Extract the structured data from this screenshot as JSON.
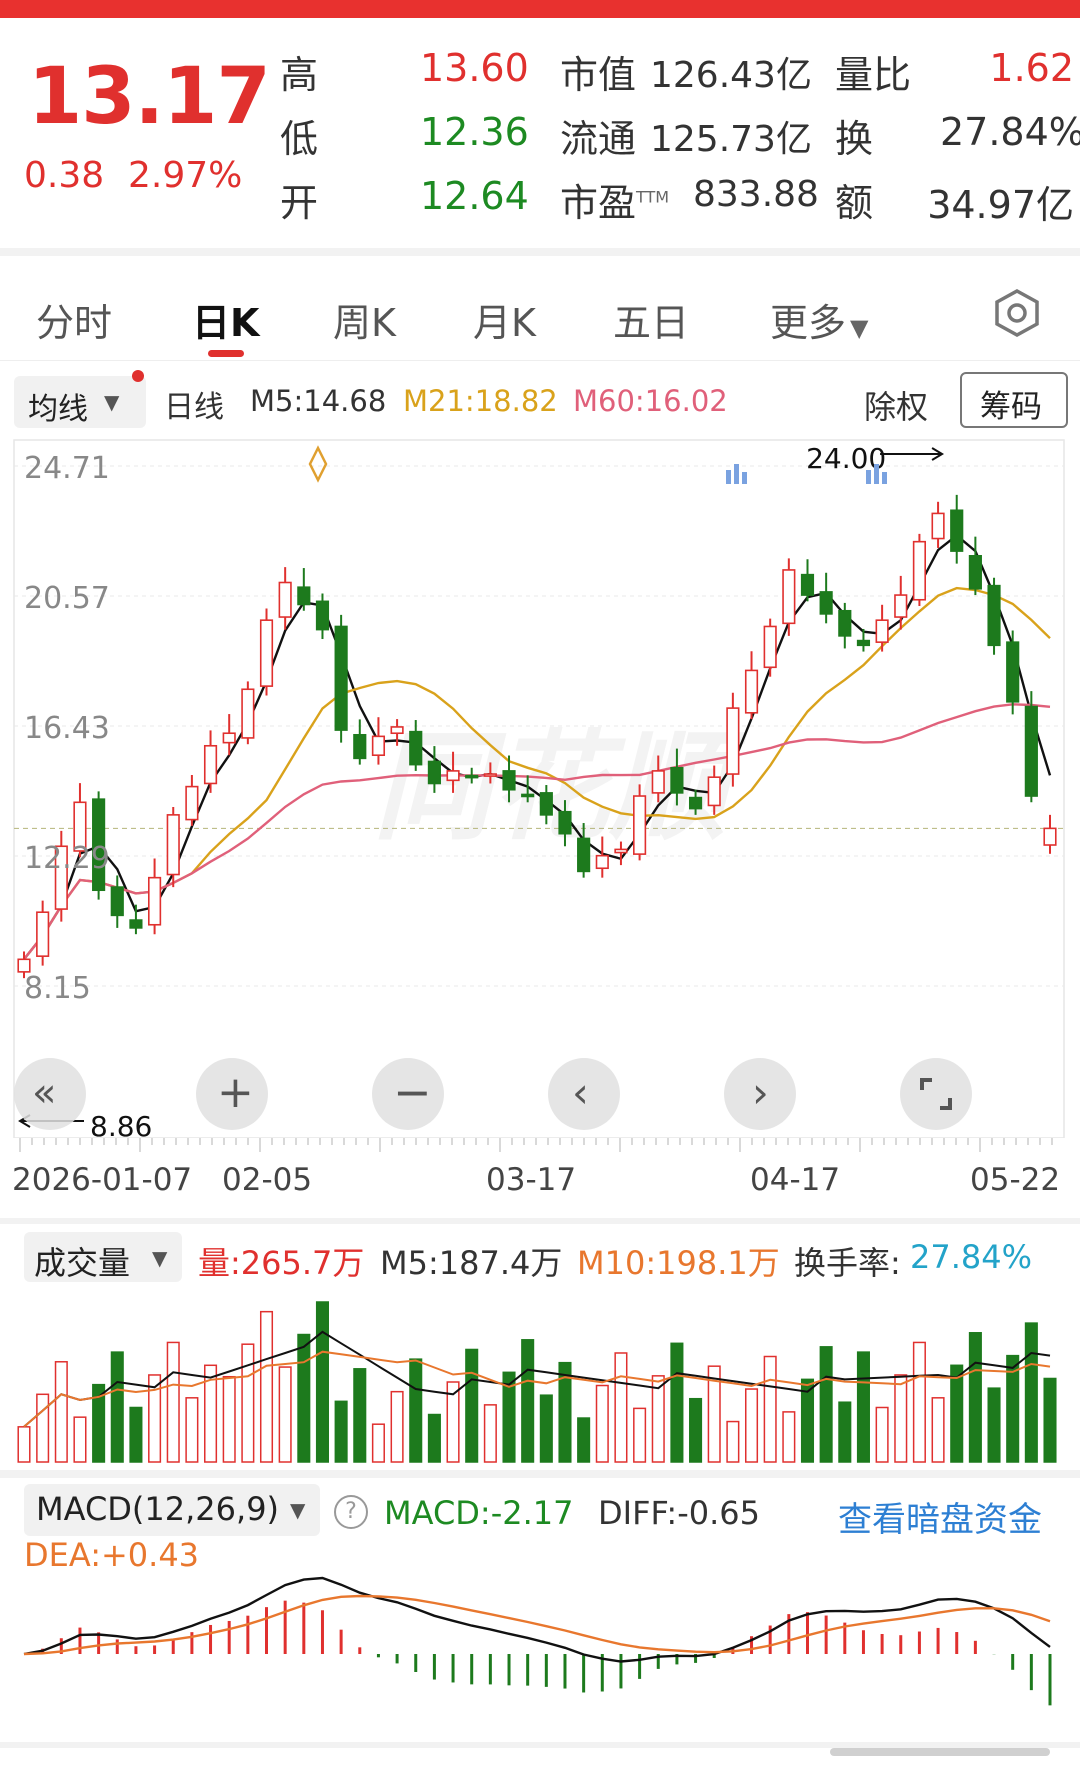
{
  "quote": {
    "price": "13.17",
    "change": "0.38",
    "change_pct": "2.97%",
    "rows": [
      {
        "label": "高",
        "value": "13.60",
        "k1": "市值",
        "v1": "126.43亿",
        "k2": "量比",
        "v2": "1.62"
      },
      {
        "label": "低",
        "value": "12.36",
        "k1": "流通",
        "v1": "125.73亿",
        "k2": "换",
        "v2": "27.84%"
      },
      {
        "label": "开",
        "value": "12.64",
        "k1": "市盈",
        "k1_sup": "TTM",
        "v1": "833.88",
        "k2": "额",
        "v2": "34.97亿"
      }
    ]
  },
  "tabs": [
    "分时",
    "日K",
    "周K",
    "月K",
    "五日",
    "更多"
  ],
  "active_tab": "日K",
  "ma_bar": {
    "dropdown": "均线",
    "period": "日线",
    "m5": "M5:14.68",
    "m21": "M21:18.82",
    "m60": "M60:16.02",
    "adjust": "除权",
    "chips": "筹码"
  },
  "kline": {
    "y_ticks": [
      "24.71",
      "20.57",
      "16.43",
      "12.29",
      "8.15"
    ],
    "high_marker": "24.00",
    "low_marker": "8.86",
    "dates": [
      "2026-01-07",
      "02-05",
      "03-17",
      "04-17",
      "05-22"
    ],
    "watermark": "同花顺"
  },
  "volume": {
    "dropdown": "成交量",
    "vol": "量:265.7万",
    "m5": "M5:187.4万",
    "m10": "M10:198.1万",
    "turnover_label": "换手率:",
    "turnover": "27.84%"
  },
  "macd": {
    "dropdown": "MACD(12,26,9)",
    "macd": "MACD:-2.17",
    "diff": "DIFF:-0.65",
    "dea": "DEA:+0.43",
    "link": "查看暗盘资金"
  },
  "colors": {
    "up": "#e0302e",
    "down": "#1d7a1d",
    "ma5": "#111111",
    "ma21": "#d9a21b",
    "ma60": "#e0607a",
    "link": "#2d7fd3"
  },
  "chart_data": {
    "type": "candlestick",
    "closes": [
      9.0,
      10.5,
      12.6,
      14.0,
      11.2,
      10.4,
      10.0,
      11.6,
      13.6,
      14.5,
      15.8,
      16.2,
      17.6,
      19.8,
      21.0,
      20.3,
      19.5,
      16.3,
      15.4,
      16.1,
      16.4,
      15.2,
      14.6,
      15.0,
      14.8,
      14.9,
      14.4,
      14.2,
      13.6,
      13.0,
      11.8,
      12.3,
      12.5,
      14.2,
      15.0,
      14.3,
      13.8,
      14.8,
      17.0,
      18.2,
      19.6,
      21.4,
      20.6,
      20.0,
      19.3,
      19.0,
      19.8,
      20.6,
      22.3,
      23.2,
      22.0,
      20.8,
      19.0,
      17.2,
      14.2,
      13.17
    ],
    "last": {
      "open": 12.64,
      "high": 13.6,
      "low": 12.36,
      "close": 13.17
    },
    "y_range": [
      8.15,
      24.71
    ],
    "x_labels": [
      "2026-01-07",
      "02-05",
      "03-17",
      "04-17",
      "05-22"
    ]
  }
}
